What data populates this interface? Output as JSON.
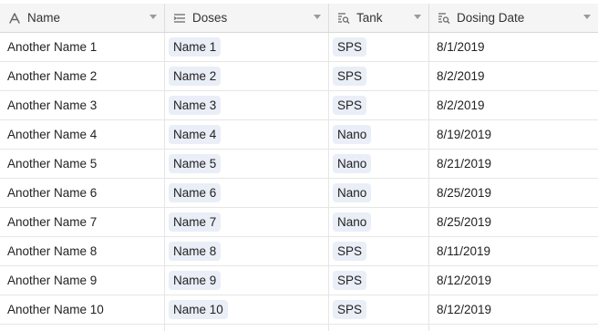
{
  "columns": [
    {
      "label": "Name",
      "icon": "text-field-icon"
    },
    {
      "label": "Doses",
      "icon": "linked-records-icon"
    },
    {
      "label": "Tank",
      "icon": "lookup-icon"
    },
    {
      "label": "Dosing Date",
      "icon": "lookup-icon"
    }
  ],
  "rows": [
    {
      "name": "Another Name 1",
      "dose": "Name 1",
      "tank": "SPS",
      "date": "8/1/2019"
    },
    {
      "name": "Another Name 2",
      "dose": "Name 2",
      "tank": "SPS",
      "date": "8/2/2019"
    },
    {
      "name": "Another Name 3",
      "dose": "Name 3",
      "tank": "SPS",
      "date": "8/2/2019"
    },
    {
      "name": "Another Name 4",
      "dose": "Name 4",
      "tank": "Nano",
      "date": "8/19/2019"
    },
    {
      "name": "Another Name 5",
      "dose": "Name 5",
      "tank": "Nano",
      "date": "8/21/2019"
    },
    {
      "name": "Another Name 6",
      "dose": "Name 6",
      "tank": "Nano",
      "date": "8/25/2019"
    },
    {
      "name": "Another Name 7",
      "dose": "Name 7",
      "tank": "Nano",
      "date": "8/25/2019"
    },
    {
      "name": "Another Name 8",
      "dose": "Name 8",
      "tank": "SPS",
      "date": "8/11/2019"
    },
    {
      "name": "Another Name 9",
      "dose": "Name 9",
      "tank": "SPS",
      "date": "8/12/2019"
    },
    {
      "name": "Another Name 10",
      "dose": "Name 10",
      "tank": "SPS",
      "date": "8/12/2019"
    }
  ],
  "colors": {
    "header_bg": "#f5f5f5",
    "pill_bg": "#e9eef7",
    "grid_line": "#e6e6e6"
  }
}
